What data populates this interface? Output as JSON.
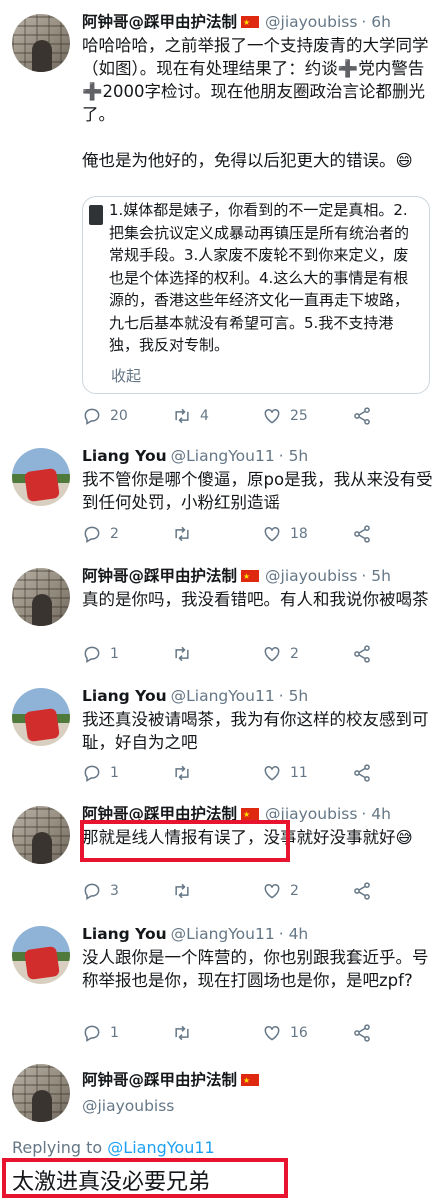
{
  "tweets": [
    {
      "name": "阿钟哥@踩甲由护法制",
      "handle": "@jiayoubiss",
      "time": "· 6h",
      "text": "哈哈哈哈，之前举报了一个支持废青的大学同学（如图）。现在有处理结果了：约谈➕党内警告➕2000字检讨。现在他朋友圈政治言论都删光了。\n\n俺也是为他好的，免得以后犯更大的错误。😄",
      "quote": {
        "text": "1.媒体都是婊子，你看到的不一定是真相。2.把集会抗议定义成暴动再镇压是所有统治者的常规手段。3.人家废不废轮不到你来定义，废也是个体选择的权利。4.这么大的事情是有根源的，香港这些年经济文化一直再走下坡路，九七后基本就没有希望可言。5.我不支持港独，我反对专制。",
        "collapse": "收起"
      },
      "actions": {
        "reply": "20",
        "retweet": "4",
        "like": "25"
      }
    },
    {
      "name": "Liang You",
      "handle": "@LiangYou11",
      "time": "· 5h",
      "text": "我不管你是哪个傻逼，原po是我，我从来没有受到任何处罚，小粉红别造谣",
      "actions": {
        "reply": "2",
        "retweet": "",
        "like": "18"
      }
    },
    {
      "name": "阿钟哥@踩甲由护法制",
      "handle": "@jiayoubiss",
      "time": "· 5h",
      "text": "真的是你吗，我没看错吧。有人和我说你被喝茶",
      "actions": {
        "reply": "1",
        "retweet": "",
        "like": "2"
      }
    },
    {
      "name": "Liang You",
      "handle": "@LiangYou11",
      "time": "· 5h",
      "text": "我还真没被请喝茶，我为有你这样的校友感到可耻，好自为之吧",
      "actions": {
        "reply": "1",
        "retweet": "",
        "like": "11"
      }
    },
    {
      "name": "阿钟哥@踩甲由护法制",
      "handle": "@jiayoubiss",
      "time": "· 4h",
      "text": "那就是线人情报有误了，没事就好没事就好😅",
      "actions": {
        "reply": "3",
        "retweet": "",
        "like": "2"
      }
    },
    {
      "name": "Liang You",
      "handle": "@LiangYou11",
      "time": "· 4h",
      "text": "没人跟你是一个阵营的，你也别跟我套近乎。号称举报也是你，现在打圆场也是你，是吧zpf?",
      "actions": {
        "reply": "1",
        "retweet": "",
        "like": "16"
      }
    }
  ],
  "final_tweet": {
    "name": "阿钟哥@踩甲由护法制",
    "handle": "@jiayoubiss",
    "replying_label": "Replying to",
    "replying_to": "@LiangYou11",
    "text": "太激进真没必要兄弟"
  },
  "colors": {
    "highlight": "#e8132e",
    "link": "#1da1f2",
    "muted": "#657786"
  }
}
